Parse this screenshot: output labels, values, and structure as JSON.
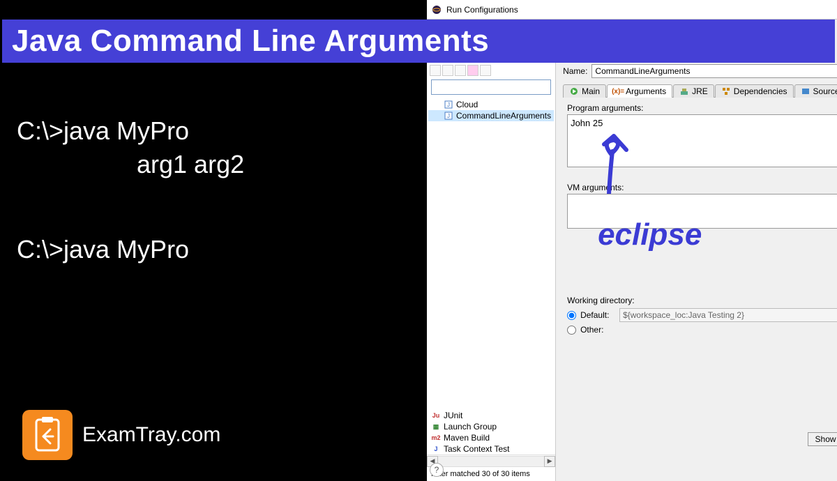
{
  "window": {
    "title": "Run Configurations"
  },
  "banner": {
    "title": "Java Command Line Arguments"
  },
  "cmd": {
    "line1": "C:\\>java MyPro",
    "line1b": "arg1 arg2",
    "line2": "C:\\>java MyPro"
  },
  "brand": {
    "name": "ExamTray.com"
  },
  "tree": {
    "filter_placeholder": "",
    "items": [
      {
        "icon": "java-class-icon",
        "label": "Cloud"
      },
      {
        "icon": "java-class-icon",
        "label": "CommandLineArguments",
        "selected": true
      }
    ],
    "bottom_items": [
      {
        "icon": "junit-icon",
        "icon_text": "Ju",
        "color": "#c03030",
        "label": "JUnit"
      },
      {
        "icon": "launch-group-icon",
        "icon_text": "▦",
        "color": "#3a8a3a",
        "label": "Launch Group"
      },
      {
        "icon": "maven-icon",
        "icon_text": "m2",
        "color": "#c03030",
        "label": "Maven Build"
      },
      {
        "icon": "task-icon",
        "icon_text": "J",
        "color": "#3355cc",
        "label": "Task Context Test"
      }
    ],
    "filter_status": "Filter matched 30 of 30 items"
  },
  "form": {
    "name_label": "Name:",
    "name_value": "CommandLineArguments",
    "tabs": [
      {
        "id": "main",
        "label": "Main",
        "icon": "run-icon"
      },
      {
        "id": "arguments",
        "label": "Arguments",
        "icon": "args-icon",
        "active": true
      },
      {
        "id": "jre",
        "label": "JRE",
        "icon": "jre-icon"
      },
      {
        "id": "dependencies",
        "label": "Dependencies",
        "icon": "deps-icon"
      },
      {
        "id": "source",
        "label": "Source",
        "icon": "source-icon"
      }
    ],
    "program_args_label": "Program arguments:",
    "program_args_value": "John 25",
    "vm_args_label": "VM arguments:",
    "vm_args_value": "",
    "working_dir_label": "Working directory:",
    "default_label": "Default:",
    "default_value": "${workspace_loc:Java Testing 2}",
    "other_label": "Other:",
    "show_button": "Show"
  },
  "annotation": {
    "label": "eclipse"
  }
}
